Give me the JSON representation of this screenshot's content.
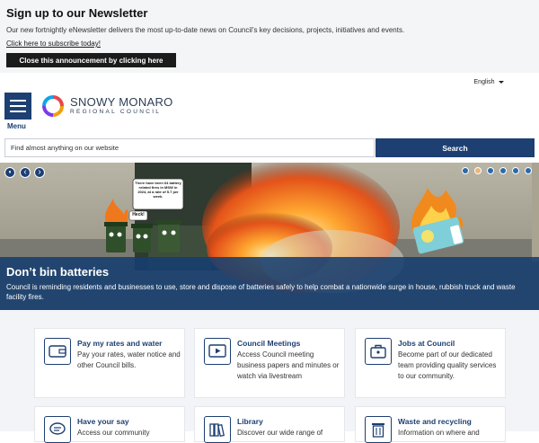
{
  "announcement": {
    "title": "Sign up to our Newsletter",
    "body": "Our new fortnightly eNewsletter delivers the most up-to-date news on Council’s key decisions, projects, initiatives and events.",
    "link": "Click here to subscribe today!",
    "close_label": "Close this announcement by clicking here"
  },
  "language": {
    "selected": "English"
  },
  "header": {
    "menu_label": "Menu",
    "logo_line1": "SNOWY MONARO",
    "logo_line2": "REGIONAL COUNCIL"
  },
  "search": {
    "placeholder": "Find almost anything on our website",
    "button": "Search"
  },
  "hero": {
    "controls": {
      "pause": "⏸",
      "prev": "‹",
      "next": "›"
    },
    "slide_count": 6,
    "active_slide": 2,
    "speech_bubble": "There have been 64 battery related fires in MSW in 2024, at a rate of 5.7 per week.",
    "exclaim": "Heck!",
    "title": "Don’t bin batteries",
    "text": "Council is reminding residents and businesses to use, store and dispose of batteries safely to help combat a nationwide surge in house, rubbish truck and waste facility fires."
  },
  "services": [
    {
      "icon": "wallet-icon",
      "title": "Pay my rates and water",
      "desc": "Pay your rates, water notice and other Council bills."
    },
    {
      "icon": "video-play-icon",
      "title": "Council Meetings",
      "desc": "Access Council meeting business papers and minutes or watch via livestream"
    },
    {
      "icon": "briefcase-icon",
      "title": "Jobs at Council",
      "desc": "Become part of our dedicated team providing quality services to our community."
    },
    {
      "icon": "chat-bubble-icon",
      "title": "Have your say",
      "desc": "Access our community"
    },
    {
      "icon": "books-icon",
      "title": "Library",
      "desc": "Discover our wide range of"
    },
    {
      "icon": "bin-icon",
      "title": "Waste and recycling",
      "desc": "Information on where and"
    }
  ],
  "colors": {
    "brand": "#1d3f72",
    "caption_bg": "#163e70",
    "active_dot": "#e9b57a"
  }
}
